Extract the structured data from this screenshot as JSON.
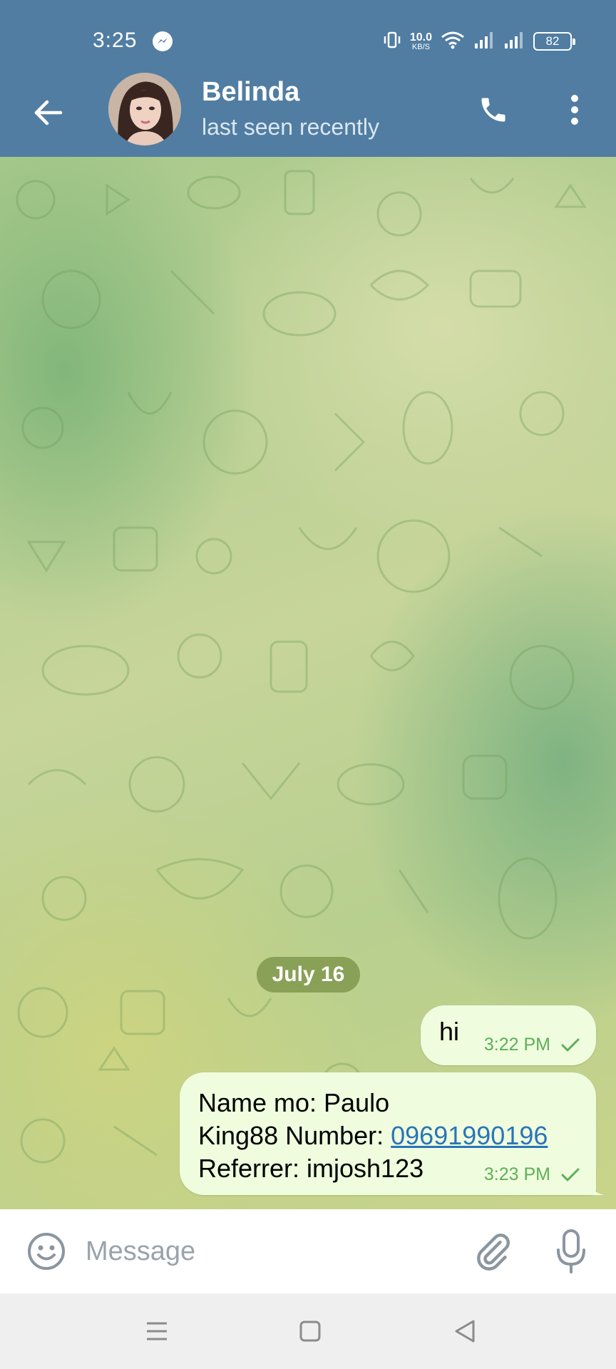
{
  "status_bar": {
    "time": "3:25",
    "net_speed_value": "10.0",
    "net_speed_unit": "KB/S",
    "battery": "82"
  },
  "header": {
    "contact_name": "Belinda",
    "contact_status": "last seen recently"
  },
  "chat": {
    "date_chip": "July 16",
    "messages": [
      {
        "text": "hi",
        "time": "3:22 PM"
      },
      {
        "lines": [
          {
            "text": "Name mo: Paulo"
          },
          {
            "prefix": "King88 Number: ",
            "link": "09691990196"
          },
          {
            "text": "Referrer: imjosh123"
          }
        ],
        "time": "3:23 PM"
      }
    ]
  },
  "input": {
    "placeholder": "Message",
    "value": ""
  },
  "colors": {
    "header": "#517da2",
    "bubble_out": "#effdde",
    "check": "#5fae5a",
    "link": "#2a74b8",
    "date_chip": "#80984e"
  },
  "icons": [
    "back-arrow-icon",
    "phone-icon",
    "more-vertical-icon",
    "emoji-icon",
    "paperclip-icon",
    "microphone-icon",
    "check-icon",
    "nav-menu-icon",
    "nav-home-icon",
    "nav-back-icon",
    "messenger-icon",
    "vibrate-icon",
    "wifi-icon",
    "signal-icon",
    "battery-icon"
  ]
}
